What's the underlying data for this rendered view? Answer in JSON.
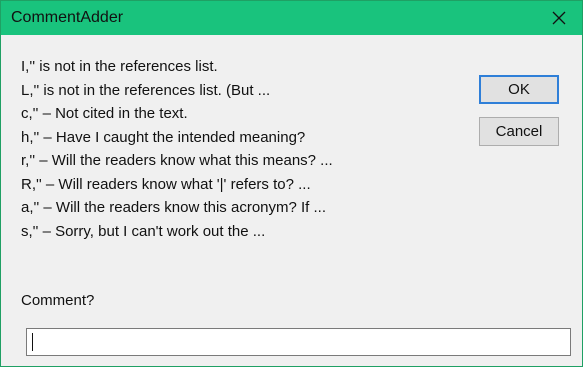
{
  "window": {
    "title": "CommentAdder"
  },
  "titlebar_icons": {
    "close": "close-icon"
  },
  "colors": {
    "titlebar": "#19c37d",
    "dialog_bg": "#f0f0f0",
    "default_button_border": "#2f7fd8"
  },
  "list_items": [
    "I,'' is not in the references list.",
    "L,'' is not in the references list. (But ...",
    "c,'' – Not cited in the text.",
    "h,'' – Have I caught the intended meaning?",
    "r,'' – Will the readers know what this means? ...",
    "R,'' – Will readers know what '|' refers to? ...",
    "a,'' – Will the readers know this acronym? If ...",
    "s,'' – Sorry, but I can't work out the ..."
  ],
  "buttons": {
    "ok": "OK",
    "cancel": "Cancel"
  },
  "comment": {
    "label": "Comment?",
    "value": ""
  }
}
